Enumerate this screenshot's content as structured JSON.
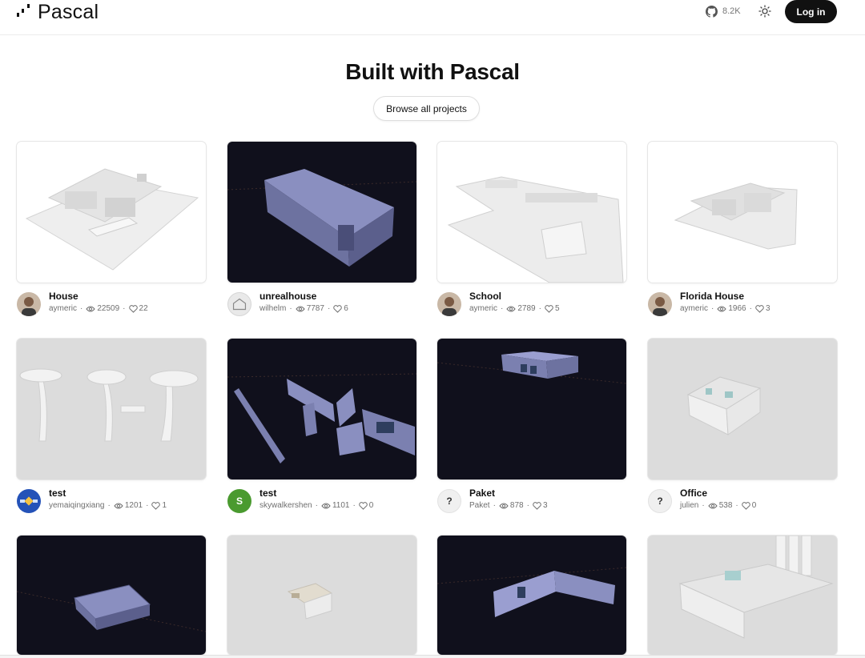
{
  "header": {
    "logo_text": "Pascal",
    "github_count": "8.2K",
    "login_label": "Log in"
  },
  "main": {
    "title": "Built with Pascal",
    "browse_label": "Browse all projects"
  },
  "projects": [
    {
      "name": "House",
      "author": "aymeric",
      "views": "22509",
      "likes": "22"
    },
    {
      "name": "unrealhouse",
      "author": "wilhelm",
      "views": "7787",
      "likes": "6"
    },
    {
      "name": "School",
      "author": "aymeric",
      "views": "2789",
      "likes": "5"
    },
    {
      "name": "Florida House",
      "author": "aymeric",
      "views": "1966",
      "likes": "3"
    },
    {
      "name": "test",
      "author": "yemaiqingxiang",
      "views": "1201",
      "likes": "1"
    },
    {
      "name": "test",
      "author": "skywalkershen",
      "views": "1101",
      "likes": "0",
      "avatar_letter": "S"
    },
    {
      "name": "Paket",
      "author": "Paket",
      "views": "878",
      "likes": "3",
      "avatar_letter": "?"
    },
    {
      "name": "Office",
      "author": "julien",
      "views": "538",
      "likes": "0",
      "avatar_letter": "?"
    }
  ],
  "icons": {
    "views": "eye-icon",
    "likes": "heart-icon",
    "github": "github-icon",
    "theme": "sun-icon"
  },
  "colors": {
    "dark_scene": "#10101c",
    "model_blue": "#7b80b0",
    "button_dark": "#111111"
  }
}
